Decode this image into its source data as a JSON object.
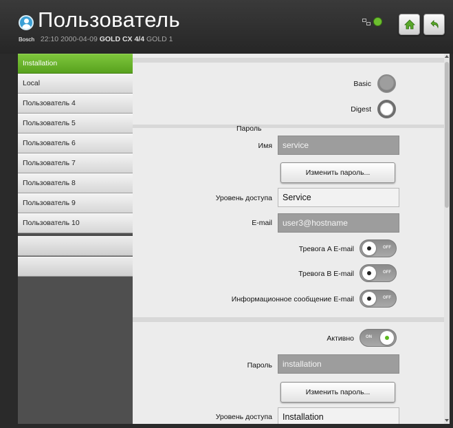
{
  "header": {
    "title": "Пользователь",
    "brand": "Bosch",
    "time": "22:10",
    "date": "2000-04-09",
    "device": "GOLD CX 4/4",
    "unit": "GOLD 1",
    "icons": [
      "network-icon",
      "user-status-icon",
      "home-icon",
      "back-icon"
    ],
    "accent": "#6cbf2f"
  },
  "sidebar": {
    "items": [
      {
        "label": "Installation",
        "active": true
      },
      {
        "label": "Local",
        "active": false
      },
      {
        "label": "Пользователь 4",
        "active": false
      },
      {
        "label": "Пользователь 5",
        "active": false
      },
      {
        "label": "Пользователь 6",
        "active": false
      },
      {
        "label": "Пользователь 7",
        "active": false
      },
      {
        "label": "Пользователь 8",
        "active": false
      },
      {
        "label": "Пользователь 9",
        "active": false
      },
      {
        "label": "Пользователь 10",
        "active": false
      },
      {
        "label": "",
        "active": false
      },
      {
        "label": "",
        "active": false
      }
    ]
  },
  "form": {
    "auth": {
      "basic_label": "Basic",
      "basic_selected": false,
      "digest_label": "Digest",
      "digest_selected": true,
      "section_label": "Пароль"
    },
    "user1": {
      "name_label": "Имя",
      "name_value": "service",
      "change_password_label": "Изменить пароль...",
      "access_label": "Уровень доступа",
      "access_value": "Service",
      "email_label": "E-mail",
      "email_value": "user3@hostname",
      "alarm_a_label": "Тревога A E-mail",
      "alarm_a_state": "OFF",
      "alarm_b_label": "Тревога B E-mail",
      "alarm_b_state": "OFF",
      "info_label": "Информационное сообщение E-mail",
      "info_state": "OFF"
    },
    "user2": {
      "active_label": "Активно",
      "active_state": "ON",
      "password_label": "Пароль",
      "password_value": "installation",
      "change_password_label": "Изменить пароль...",
      "access_label": "Уровень доступа",
      "access_value": "Installation"
    }
  }
}
